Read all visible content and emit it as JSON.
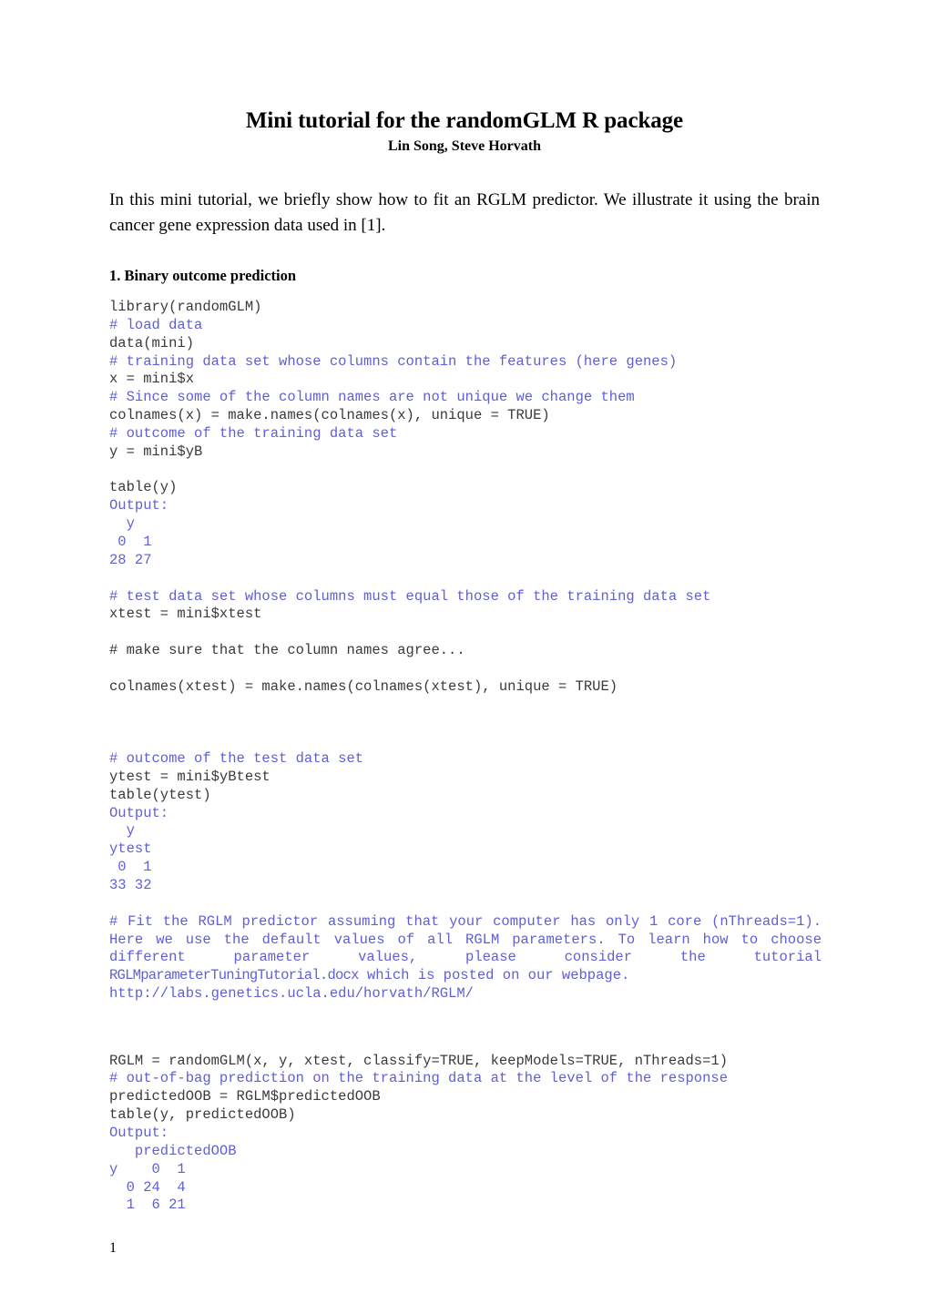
{
  "document": {
    "title": "Mini tutorial for the randomGLM R package",
    "authors": "Lin Song, Steve Horvath",
    "intro": "In this mini tutorial, we briefly show how to fit an RGLM predictor. We illustrate it using the brain cancer gene expression data used in [1].",
    "section_1_heading": "1. Binary outcome prediction",
    "page_number": "1"
  },
  "colors": {
    "comment_blue": "#5f5fd6",
    "code_gray": "#3a3a3a",
    "text_black": "#000000",
    "background": "#ffffff"
  },
  "code": {
    "block_1": [
      {
        "text": "library(randomGLM)",
        "kind": "code"
      },
      {
        "text": "# load data",
        "kind": "comment"
      },
      {
        "text": "data(mini)",
        "kind": "code"
      },
      {
        "text": "# training data set whose columns contain the features (here genes)",
        "kind": "comment"
      },
      {
        "text": "x = mini$x",
        "kind": "code"
      },
      {
        "text": "# Since some of the column names are not unique we change them",
        "kind": "comment"
      },
      {
        "text": "colnames(x) = make.names(colnames(x), unique = TRUE)",
        "kind": "code"
      },
      {
        "text": "# outcome of the training data set",
        "kind": "comment"
      },
      {
        "text": "y = mini$yB",
        "kind": "code"
      },
      {
        "text": "",
        "kind": "blank"
      },
      {
        "text": "table(y)",
        "kind": "code"
      },
      {
        "text": "Output:",
        "kind": "output"
      },
      {
        "text": "  y",
        "kind": "output"
      },
      {
        "text": " 0  1",
        "kind": "output"
      },
      {
        "text": "28 27",
        "kind": "output"
      },
      {
        "text": "",
        "kind": "blank"
      },
      {
        "text": "# test data set whose columns must equal those of the training data set",
        "kind": "comment"
      },
      {
        "text": "xtest = mini$xtest",
        "kind": "code"
      },
      {
        "text": "",
        "kind": "blank"
      },
      {
        "text": "# make sure that the column names agree...",
        "kind": "code"
      },
      {
        "text": "",
        "kind": "blank"
      },
      {
        "text": "colnames(xtest) = make.names(colnames(xtest), unique = TRUE)",
        "kind": "code"
      },
      {
        "text": "",
        "kind": "blank"
      },
      {
        "text": "",
        "kind": "blank"
      },
      {
        "text": "",
        "kind": "blank"
      },
      {
        "text": "# outcome of the test data set",
        "kind": "comment"
      },
      {
        "text": "ytest = mini$yBtest",
        "kind": "code"
      },
      {
        "text": "table(ytest)",
        "kind": "code"
      },
      {
        "text": "Output:",
        "kind": "output"
      },
      {
        "text": "  y",
        "kind": "output"
      },
      {
        "text": "ytest",
        "kind": "output"
      },
      {
        "text": " 0  1",
        "kind": "output"
      },
      {
        "text": "33 32",
        "kind": "output"
      },
      {
        "text": "",
        "kind": "blank"
      }
    ],
    "justified_comment": {
      "part_1": "# Fit the RGLM predictor assuming that your computer has only 1 core (nThreads=1). Here we use the default values of all RGLM parameters. To learn how to choose different parameter values, please consider the tutorial ",
      "tutorial_file": "RGLMparameterTuningTutorial.docx",
      "part_2": " which is posted on our webpage.",
      "url": "http://labs.genetics.ucla.edu/horvath/RGLM/"
    },
    "block_2": [
      {
        "text": "",
        "kind": "blank"
      },
      {
        "text": "",
        "kind": "blank"
      },
      {
        "text": "RGLM = randomGLM(x, y, xtest, classify=TRUE, keepModels=TRUE, nThreads=1)",
        "kind": "code"
      },
      {
        "text": "# out-of-bag prediction on the training data at the level of the response",
        "kind": "comment"
      },
      {
        "text": "predictedOOB = RGLM$predictedOOB",
        "kind": "code"
      },
      {
        "text": "table(y, predictedOOB)",
        "kind": "code"
      },
      {
        "text": "Output:",
        "kind": "output"
      },
      {
        "text": "   predictedOOB",
        "kind": "output"
      },
      {
        "text": "y    0  1",
        "kind": "output"
      },
      {
        "text": "  0 24  4",
        "kind": "output"
      },
      {
        "text": "  1  6 21",
        "kind": "output"
      }
    ]
  },
  "tables": {
    "train_outcome": {
      "label": "table(y)",
      "header": "y",
      "levels": [
        "0",
        "1"
      ],
      "counts": [
        28,
        27
      ]
    },
    "test_outcome": {
      "label": "table(ytest)",
      "header": "y",
      "var": "ytest",
      "levels": [
        "0",
        "1"
      ],
      "counts": [
        33,
        32
      ]
    },
    "confusion_matrix": {
      "label": "table(y, predictedOOB)",
      "col_header": "predictedOOB",
      "row_header": "y",
      "col_levels": [
        "0",
        "1"
      ],
      "row_levels": [
        "0",
        "1"
      ],
      "values": [
        [
          24,
          4
        ],
        [
          6,
          21
        ]
      ]
    }
  }
}
